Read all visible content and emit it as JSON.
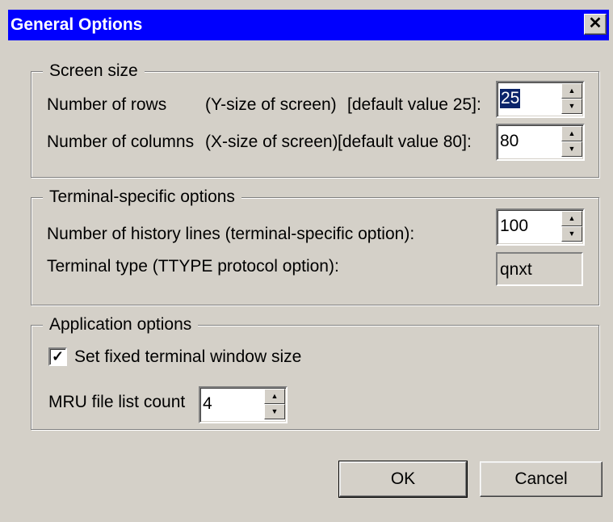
{
  "window": {
    "title": "General Options",
    "close_glyph": "✕"
  },
  "screen_size": {
    "title": "Screen size",
    "rows_label": "Number of rows",
    "rows_hint": "(Y-size of screen)",
    "rows_default": "[default value 25]:",
    "rows_value": "25",
    "cols_label": "Number of columns",
    "cols_hint": "(X-size of screen)",
    "cols_default": "[default value 80]:",
    "cols_value": "80"
  },
  "terminal": {
    "title": "Terminal-specific options",
    "history_label": "Number of history lines (terminal-specific option):",
    "history_value": "100",
    "type_label": "Terminal type (TTYPE protocol option):",
    "type_value": "qnxt"
  },
  "application": {
    "title": "Application options",
    "fixed_size_label": "Set fixed terminal window size",
    "fixed_size_checked": true,
    "check_glyph": "✓",
    "mru_label": "MRU file list count",
    "mru_value": "4"
  },
  "buttons": {
    "ok": "OK",
    "cancel": "Cancel"
  },
  "arrows": {
    "up": "▲",
    "down": "▼"
  },
  "colors": {
    "titlebar": "#0000fe",
    "face": "#d4d0c8",
    "selection": "#0a246a"
  }
}
